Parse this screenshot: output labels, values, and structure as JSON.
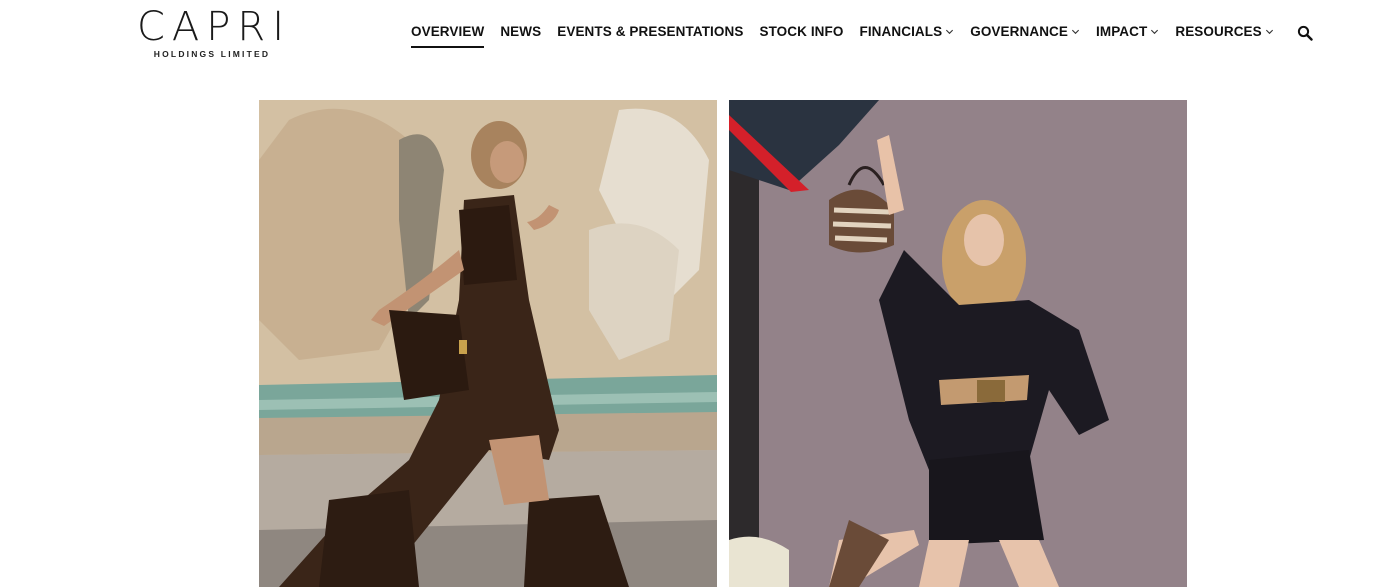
{
  "brand": {
    "name": "CAPRI",
    "subtitle": "HOLDINGS LIMITED"
  },
  "nav": {
    "items": [
      {
        "label": "OVERVIEW",
        "active": true,
        "dropdown": false
      },
      {
        "label": "NEWS",
        "active": false,
        "dropdown": false
      },
      {
        "label": "EVENTS & PRESENTATIONS",
        "active": false,
        "dropdown": false
      },
      {
        "label": "STOCK INFO",
        "active": false,
        "dropdown": false
      },
      {
        "label": "FINANCIALS",
        "active": false,
        "dropdown": true
      },
      {
        "label": "GOVERNANCE",
        "active": false,
        "dropdown": true
      },
      {
        "label": "IMPACT",
        "active": false,
        "dropdown": true
      },
      {
        "label": "RESOURCES",
        "active": false,
        "dropdown": true
      }
    ]
  },
  "icons": {
    "search": "search-icon",
    "dropdown": "chevron-down-icon"
  },
  "colors": {
    "text": "#111111",
    "background": "#ffffff"
  }
}
